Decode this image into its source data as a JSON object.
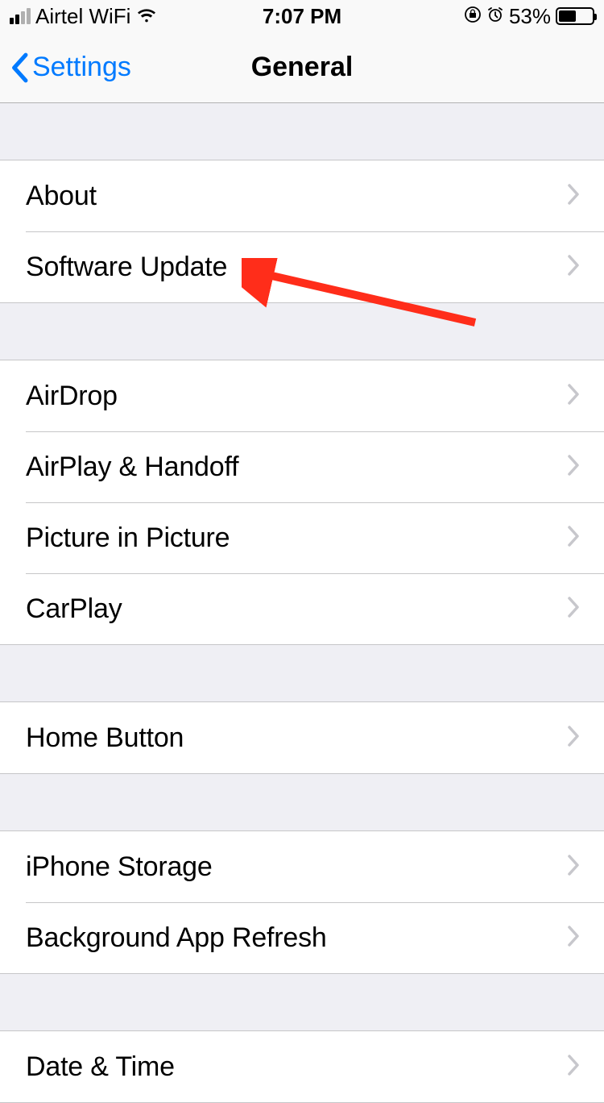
{
  "status": {
    "carrier": "Airtel WiFi",
    "time": "7:07 PM",
    "battery_percent": "53%",
    "battery_fill_width": "53%"
  },
  "nav": {
    "back_label": "Settings",
    "title": "General"
  },
  "sections": [
    {
      "rows": [
        {
          "label": "About"
        },
        {
          "label": "Software Update"
        }
      ]
    },
    {
      "rows": [
        {
          "label": "AirDrop"
        },
        {
          "label": "AirPlay & Handoff"
        },
        {
          "label": "Picture in Picture"
        },
        {
          "label": "CarPlay"
        }
      ]
    },
    {
      "rows": [
        {
          "label": "Home Button"
        }
      ]
    },
    {
      "rows": [
        {
          "label": "iPhone Storage"
        },
        {
          "label": "Background App Refresh"
        }
      ]
    },
    {
      "rows": [
        {
          "label": "Date & Time"
        }
      ]
    }
  ]
}
